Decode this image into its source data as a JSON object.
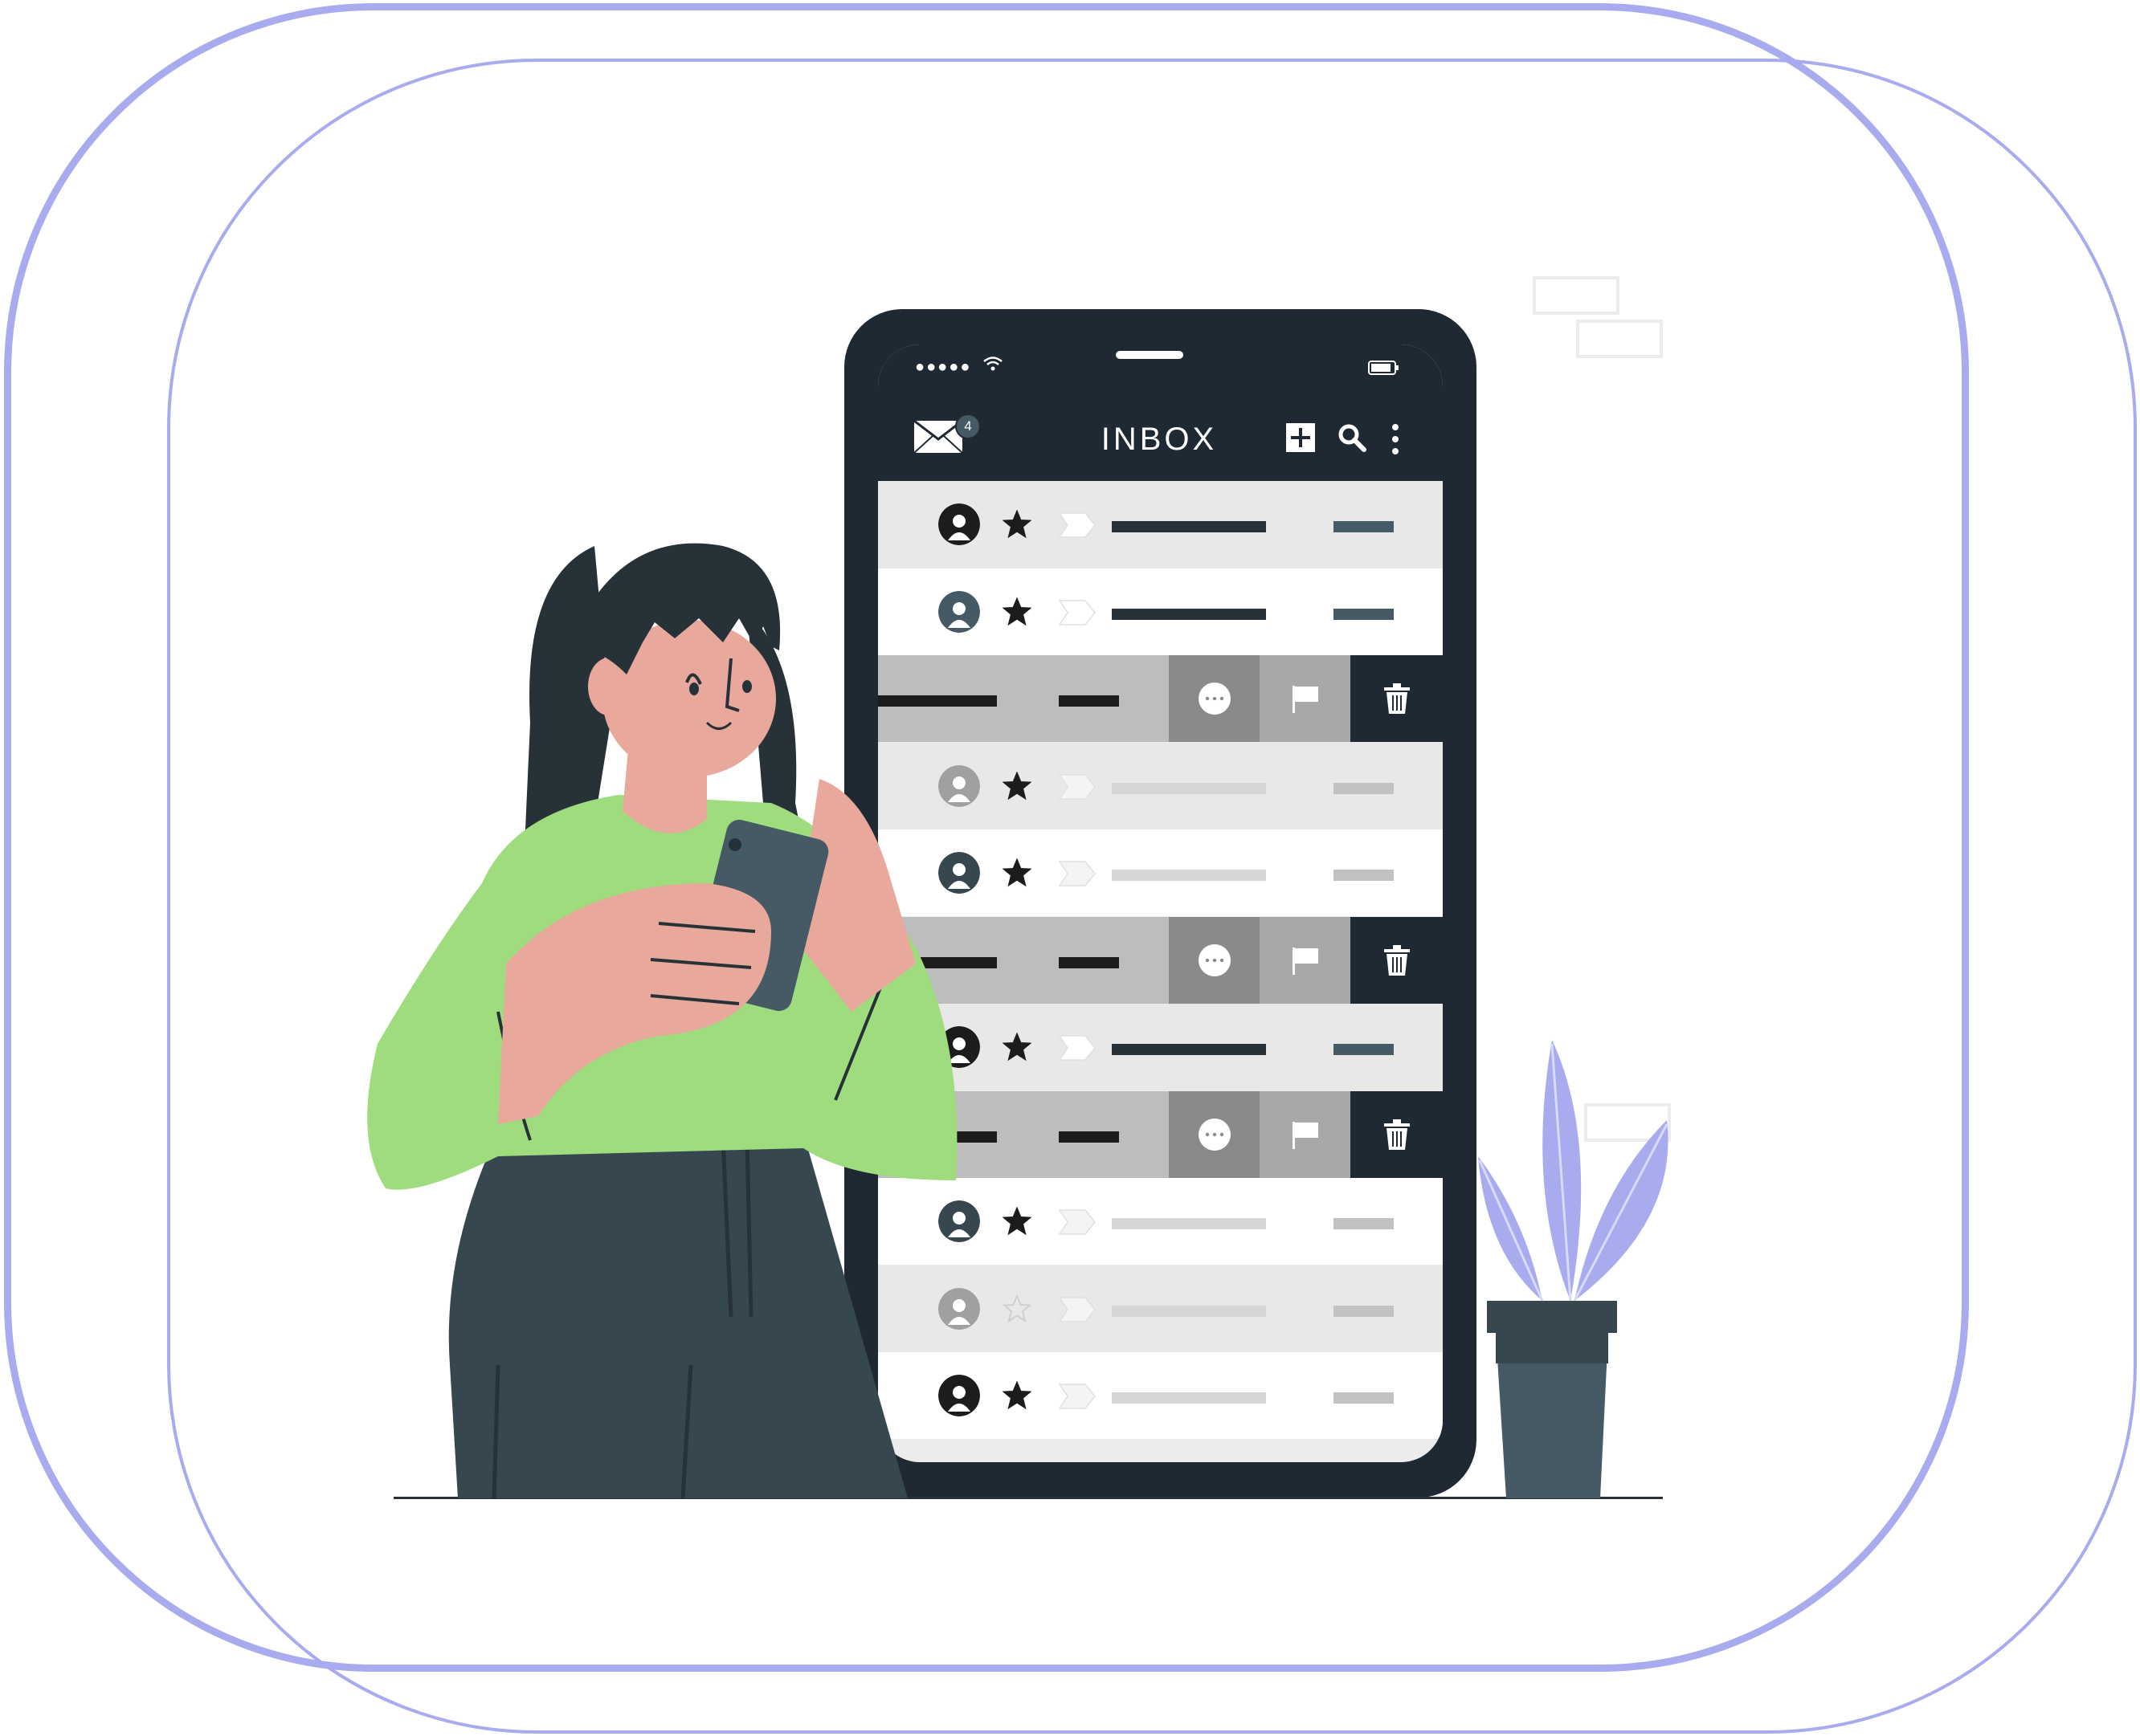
{
  "app": {
    "title": "INBOX",
    "badge_count": "4"
  },
  "colors": {
    "phone_frame": "#1f2933",
    "accent_frame": "#a9abef",
    "shirt": "#9edc7e",
    "skin": "#e8a89b",
    "pants": "#37474f",
    "plant_leaves": "#a9abef",
    "pot": "#455a64"
  },
  "icons": {
    "mail": "mail-icon",
    "add": "add-icon",
    "search": "search-icon",
    "more": "more-vertical-icon",
    "star": "star-icon",
    "label": "label-tag-icon",
    "flag": "flag-icon",
    "delete": "trash-icon"
  },
  "rows": [
    {
      "type": "message",
      "read": false,
      "starred": true
    },
    {
      "type": "message",
      "read": false,
      "starred": true
    },
    {
      "type": "swiped"
    },
    {
      "type": "message",
      "read": true,
      "starred": true
    },
    {
      "type": "message",
      "read": true,
      "starred": true
    },
    {
      "type": "swiped"
    },
    {
      "type": "message",
      "read": false,
      "starred": true
    },
    {
      "type": "swiped"
    },
    {
      "type": "message",
      "read": true,
      "starred": true
    },
    {
      "type": "message",
      "read": true,
      "starred": false
    },
    {
      "type": "message",
      "read": true,
      "starred": true
    }
  ]
}
